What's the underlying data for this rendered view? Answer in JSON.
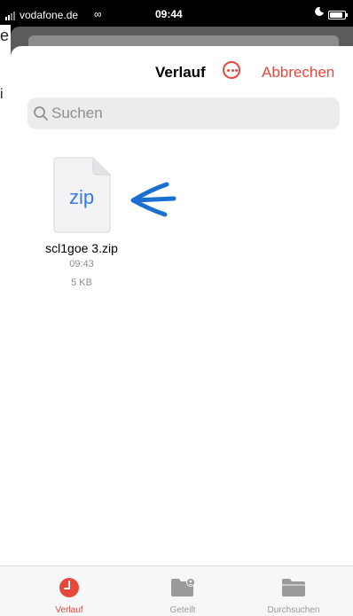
{
  "status_bar": {
    "carrier": "vodafone.de",
    "link_glyph": "∞",
    "time": "09:44",
    "icons": [
      "signal-icon",
      "link-icon",
      "moon-icon",
      "battery-icon"
    ]
  },
  "background_app": {
    "visible_chars": [
      "e",
      "i"
    ]
  },
  "nav": {
    "title": "Verlauf",
    "more_icon": "ellipsis-circle-icon",
    "cancel_label": "Abbrechen"
  },
  "search": {
    "placeholder": "Suchen",
    "icon": "magnifier-icon"
  },
  "files": [
    {
      "extension": "zip",
      "name": "scl1goe 3.zip",
      "time": "09:43",
      "size": "5 KB",
      "annotation": "blue-arrow-icon"
    }
  ],
  "tabs": [
    {
      "label": "Verlauf",
      "icon": "clock-icon",
      "active": true
    },
    {
      "label": "Geteilt",
      "icon": "shared-folder-icon",
      "active": false
    },
    {
      "label": "Durchsuchen",
      "icon": "folder-icon",
      "active": false
    }
  ],
  "colors": {
    "accent": "#e8473b",
    "file_ext": "#3478f6",
    "annotation": "#1a6fd0",
    "secondary_text": "#8e8e93"
  }
}
